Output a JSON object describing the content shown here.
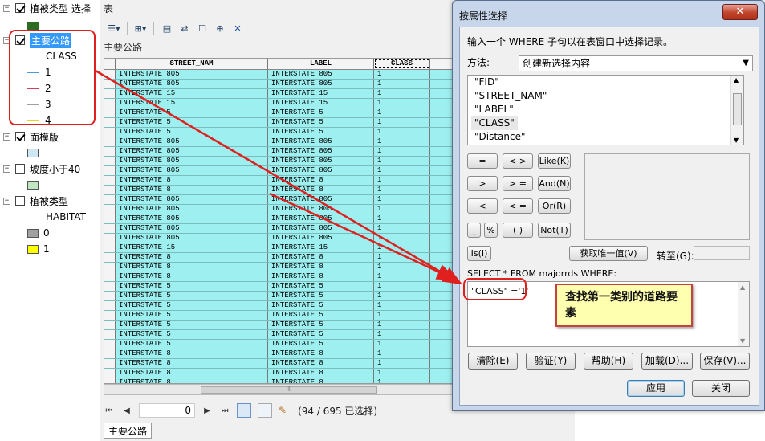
{
  "toc": {
    "layers": [
      {
        "name": "植被类型 选择",
        "checked": true
      },
      {
        "name": "主要公路",
        "checked": true,
        "field": "CLASS",
        "classes": [
          "1",
          "2",
          "3",
          "4"
        ]
      },
      {
        "name": "面模版",
        "checked": true
      },
      {
        "name": "坡度小于40",
        "checked": false
      },
      {
        "name": "植被类型",
        "checked": false,
        "field": "HABITAT",
        "classes": [
          "0",
          "1"
        ]
      }
    ],
    "colors": {
      "selected_highlight": "#3399ff",
      "veg_select_symbol": "#2d6b22",
      "class_1": "#4a9ad8",
      "class_2": "#d0405e",
      "class_3": "#a0a0a0",
      "class_4": "#e8d020",
      "template_fill": "#cfe6f4",
      "slope_fill": "#bfe6c0",
      "habitat_0": "#a0a0a0",
      "habitat_1": "#ffff00"
    }
  },
  "table": {
    "title": "表",
    "subtitle": "主要公路",
    "columns": [
      "STREET_NAM",
      "LABEL",
      "CLASS"
    ],
    "rows": [
      [
        "INTERSTATE 805",
        "INTERSTATE 805",
        "1"
      ],
      [
        "INTERSTATE 805",
        "INTERSTATE 805",
        "1"
      ],
      [
        "INTERSTATE 15",
        "INTERSTATE 15",
        "1"
      ],
      [
        "INTERSTATE 15",
        "INTERSTATE 15",
        "1"
      ],
      [
        "INTERSTATE 5",
        "INTERSTATE 5",
        "1"
      ],
      [
        "INTERSTATE 5",
        "INTERSTATE 5",
        "1"
      ],
      [
        "INTERSTATE 5",
        "INTERSTATE 5",
        "1"
      ],
      [
        "INTERSTATE 805",
        "INTERSTATE 805",
        "1"
      ],
      [
        "INTERSTATE 805",
        "INTERSTATE 805",
        "1"
      ],
      [
        "INTERSTATE 805",
        "INTERSTATE 805",
        "1"
      ],
      [
        "INTERSTATE 805",
        "INTERSTATE 805",
        "1"
      ],
      [
        "INTERSTATE 8",
        "INTERSTATE 8",
        "1"
      ],
      [
        "INTERSTATE 8",
        "INTERSTATE 8",
        "1"
      ],
      [
        "INTERSTATE 805",
        "INTERSTATE 805",
        "1"
      ],
      [
        "INTERSTATE 805",
        "INTERSTATE 805",
        "1"
      ],
      [
        "INTERSTATE 805",
        "INTERSTATE 805",
        "1"
      ],
      [
        "INTERSTATE 805",
        "INTERSTATE 805",
        "1"
      ],
      [
        "INTERSTATE 805",
        "INTERSTATE 805",
        "1"
      ],
      [
        "INTERSTATE 15",
        "INTERSTATE 15",
        "1"
      ],
      [
        "INTERSTATE 8",
        "INTERSTATE 8",
        "1"
      ],
      [
        "INTERSTATE 8",
        "INTERSTATE 8",
        "1"
      ],
      [
        "INTERSTATE 8",
        "INTERSTATE 8",
        "1"
      ],
      [
        "INTERSTATE 5",
        "INTERSTATE 5",
        "1"
      ],
      [
        "INTERSTATE 5",
        "INTERSTATE 5",
        "1"
      ],
      [
        "INTERSTATE 5",
        "INTERSTATE 5",
        "1"
      ],
      [
        "INTERSTATE 5",
        "INTERSTATE 5",
        "1"
      ],
      [
        "INTERSTATE 5",
        "INTERSTATE 5",
        "1"
      ],
      [
        "INTERSTATE 5",
        "INTERSTATE 5",
        "1"
      ],
      [
        "INTERSTATE 5",
        "INTERSTATE 5",
        "1"
      ],
      [
        "INTERSTATE 8",
        "INTERSTATE 8",
        "1"
      ],
      [
        "INTERSTATE 8",
        "INTERSTATE 8",
        "1"
      ],
      [
        "INTERSTATE 8",
        "INTERSTATE 8",
        "1"
      ],
      [
        "INTERSTATE 8",
        "INTERSTATE 8",
        "1"
      ],
      [
        "INTERSTATE 8",
        "INTERSTATE 8",
        "1"
      ]
    ],
    "record_index": "0",
    "selection_status": "(94 / 695 已选择)",
    "bottom_tab": "主要公路",
    "row_color": "#9ef0f0"
  },
  "dialog": {
    "title": "按属性选择",
    "close_symbol": "✕",
    "instruction": "输入一个 WHERE 子句以在表窗口中选择记录。",
    "method_label": "方法:",
    "method_value": "创建新选择内容",
    "fields": [
      "\"FID\"",
      "\"STREET_NAM\"",
      "\"LABEL\"",
      "\"CLASS\"",
      "\"Distance\""
    ],
    "operators": {
      "eq": "=",
      "ne": "< >",
      "like": "Like(K)",
      "gt": ">",
      "ge": "> =",
      "and": "And(N)",
      "lt": "<",
      "le": "< =",
      "or": "Or(R)",
      "underscore": "_",
      "percent": "%",
      "parens": "( )",
      "not": "Not(T)",
      "is": "Is(I)"
    },
    "unique_values_button": "获取唯一值(V)",
    "goto_label": "转至(G):",
    "sql_label": "SELECT * FROM majorrds WHERE:",
    "sql_text": "\"CLASS\" ='1'",
    "annotation": "查找第一类别的道路要素",
    "buttons": {
      "clear": "清除(E)",
      "verify": "验证(Y)",
      "help": "帮助(H)",
      "load": "加载(D)...",
      "save": "保存(V)...",
      "apply": "应用",
      "close": "关闭"
    },
    "colors": {
      "annotation_bg": "#ffffb0",
      "callout_red": "#e0201e"
    }
  }
}
